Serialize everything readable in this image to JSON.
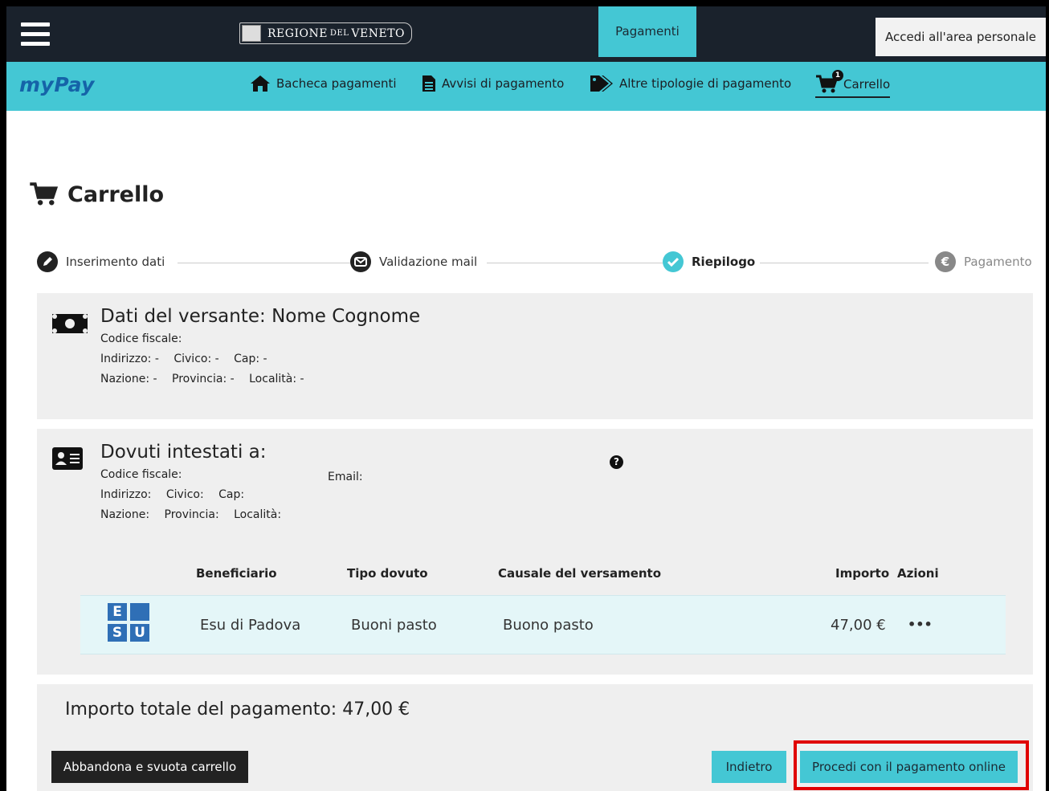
{
  "header": {
    "region_logo_text_1": "REGIONE",
    "region_logo_text_2": "DEL",
    "region_logo_text_3": "VENETO",
    "pagamenti_tab": "Pagamenti",
    "accedi_button": "Accedi all'area personale"
  },
  "nav": {
    "brand": "myPay",
    "items": [
      {
        "label": "Bacheca pagamenti",
        "icon": "home-icon"
      },
      {
        "label": "Avvisi di pagamento",
        "icon": "document-icon"
      },
      {
        "label": "Altre tipologie di pagamento",
        "icon": "tags-icon"
      },
      {
        "label": "Carrello",
        "icon": "cart-icon",
        "badge": "1"
      }
    ]
  },
  "page": {
    "title": "Carrello"
  },
  "stepper": {
    "steps": [
      {
        "label": "Inserimento dati",
        "icon": "pencil-icon"
      },
      {
        "label": "Validazione mail",
        "icon": "envelope-icon"
      },
      {
        "label": "Riepilogo",
        "icon": "check-icon"
      },
      {
        "label": "Pagamento",
        "icon": "euro-icon"
      }
    ]
  },
  "versante": {
    "title": "Dati del versante: Nome Cognome",
    "codice_fiscale": "Codice fiscale:",
    "indirizzo": "Indirizzo: -",
    "civico": "Civico: -",
    "cap": "Cap: -",
    "nazione": "Nazione: -",
    "provincia": "Provincia: -",
    "localita": "Località: -"
  },
  "dovuti": {
    "title": "Dovuti intestati a:",
    "codice_fiscale": "Codice fiscale:",
    "email": "Email:",
    "indirizzo": "Indirizzo:",
    "civico": "Civico:",
    "cap": "Cap:",
    "nazione": "Nazione:",
    "provincia": "Provincia:",
    "localita": "Località:"
  },
  "table": {
    "headers": [
      "Beneficiario",
      "Tipo dovuto",
      "Causale del versamento",
      "Importo",
      "Azioni"
    ],
    "rows": [
      {
        "beneficiario": "Esu di Padova",
        "tipo": "Buoni pasto",
        "causale": "Buono pasto",
        "importo": "47,00 €",
        "azioni": "•••",
        "logo_letters": [
          "E",
          "S",
          "U"
        ]
      }
    ]
  },
  "totale": {
    "label": "Importo totale del pagamento: 47,00 €"
  },
  "buttons": {
    "abbandona": "Abbandona e svuota carrello",
    "indietro": "Indietro",
    "procedi": "Procedi con il pagamento online"
  },
  "colors": {
    "accent": "#44c7d4",
    "dark": "#1a222c",
    "highlight": "#e00000"
  }
}
